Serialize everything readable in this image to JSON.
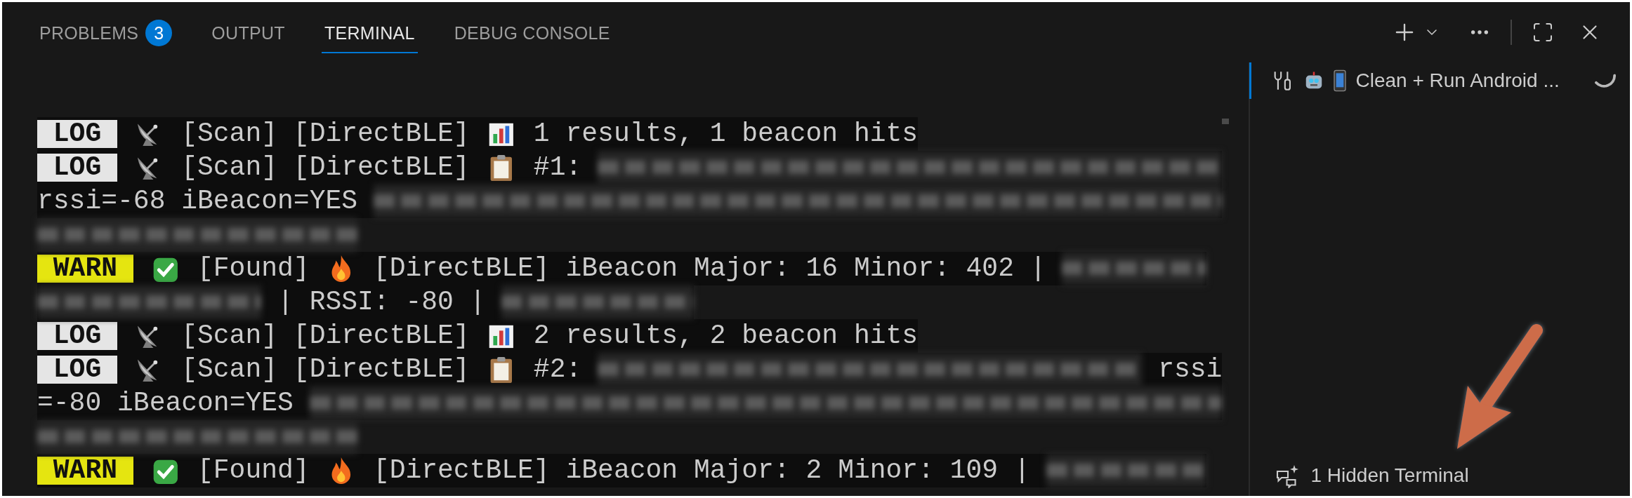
{
  "tabs": [
    {
      "label": "PROBLEMS",
      "badge": "3",
      "selected": false
    },
    {
      "label": "OUTPUT",
      "selected": false
    },
    {
      "label": "TERMINAL",
      "selected": true
    },
    {
      "label": "DEBUG CONSOLE",
      "selected": false
    }
  ],
  "terminal": {
    "lines": [
      {
        "segments": [
          {
            "kind": "badge",
            "color": "#e5e5e5",
            "text": "LOG"
          },
          {
            "kind": "dish"
          },
          {
            "kind": "text",
            "text": "[Scan] [DirectBLE]"
          },
          {
            "kind": "chart"
          },
          {
            "kind": "text",
            "text": "1 results, 1 beacon hits"
          }
        ]
      },
      {
        "segments": [
          {
            "kind": "badge",
            "color": "#e5e5e5",
            "text": "LOG"
          },
          {
            "kind": "dish"
          },
          {
            "kind": "text",
            "text": "[Scan] [DirectBLE]"
          },
          {
            "kind": "clipboard"
          },
          {
            "kind": "text",
            "text": "#1:"
          },
          {
            "kind": "redacted"
          }
        ]
      },
      {
        "segments": [
          {
            "kind": "text",
            "text": "rssi=-68 iBeacon=YES"
          },
          {
            "kind": "redacted"
          }
        ]
      },
      {
        "segments": [
          {
            "kind": "redacted"
          }
        ]
      },
      {
        "segments": [
          {
            "kind": "badge",
            "color": "#e5e510",
            "text": "WARN"
          },
          {
            "kind": "check"
          },
          {
            "kind": "text",
            "text": "[Found]"
          },
          {
            "kind": "fire"
          },
          {
            "kind": "text",
            "text": "[DirectBLE] iBeacon Major: 16 Minor: 402 |"
          },
          {
            "kind": "redacted"
          }
        ]
      },
      {
        "segments": [
          {
            "kind": "redacted"
          },
          {
            "kind": "text",
            "text": "| RSSI: -80 |"
          },
          {
            "kind": "redacted"
          }
        ]
      },
      {
        "segments": [
          {
            "kind": "badge",
            "color": "#e5e5e5",
            "text": "LOG"
          },
          {
            "kind": "dish"
          },
          {
            "kind": "text",
            "text": "[Scan] [DirectBLE]"
          },
          {
            "kind": "chart"
          },
          {
            "kind": "text",
            "text": "2 results, 2 beacon hits"
          }
        ]
      },
      {
        "segments": [
          {
            "kind": "badge",
            "color": "#e5e5e5",
            "text": "LOG"
          },
          {
            "kind": "dish"
          },
          {
            "kind": "text",
            "text": "[Scan] [DirectBLE]"
          },
          {
            "kind": "clipboard"
          },
          {
            "kind": "text",
            "text": "#2:"
          },
          {
            "kind": "redacted"
          },
          {
            "kind": "text",
            "text": "rssi"
          }
        ]
      },
      {
        "segments": [
          {
            "kind": "text",
            "text": "=-80 iBeacon=YES"
          },
          {
            "kind": "redacted"
          }
        ]
      },
      {
        "segments": [
          {
            "kind": "redacted"
          }
        ]
      },
      {
        "segments": [
          {
            "kind": "badge",
            "color": "#e5e510",
            "text": "WARN"
          },
          {
            "kind": "check"
          },
          {
            "kind": "text",
            "text": "[Found]"
          },
          {
            "kind": "fire"
          },
          {
            "kind": "text",
            "text": "[DirectBLE] iBeacon Major: 2 Minor: 109 |"
          },
          {
            "kind": "redacted"
          }
        ]
      }
    ]
  },
  "terminal_list": {
    "items": [
      {
        "label": "Clean + Run Android ...",
        "selected": true
      }
    ],
    "hidden": {
      "label": "1 Hidden Terminal"
    }
  }
}
